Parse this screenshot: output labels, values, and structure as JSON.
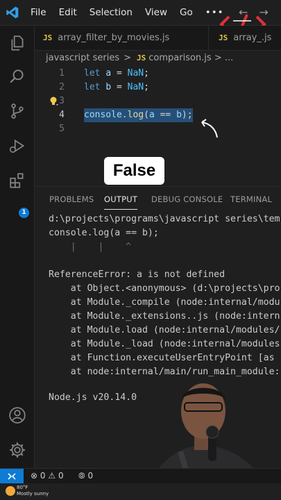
{
  "menu": {
    "file": "File",
    "edit": "Edit",
    "selection": "Selection",
    "view": "View",
    "go": "Go",
    "more": "•••"
  },
  "nav": {
    "back": "←",
    "forward": "→"
  },
  "tabs": [
    {
      "icon": "JS",
      "label": "array_filter_by_movies.js"
    },
    {
      "icon": "JS",
      "label": "array_.js"
    }
  ],
  "breadcrumb": {
    "folder": "javascript series",
    "chevron": ">",
    "icon": "JS",
    "file": "comparison.js",
    "more": "> ..."
  },
  "editor": {
    "lines": [
      {
        "num": "1",
        "kw": "let",
        "var": "a",
        "op": " = ",
        "val": "NaN",
        "end": ";"
      },
      {
        "num": "2",
        "kw": "let",
        "var": "b",
        "op": " = ",
        "val": "NaN",
        "end": ";"
      },
      {
        "num": "3"
      },
      {
        "num": "4",
        "obj": "console",
        "dot": ".",
        "fn": "log",
        "args_open": "(",
        "a": "a",
        "cmp": " == ",
        "b": "b",
        "args_close": ");"
      },
      {
        "num": "5"
      }
    ]
  },
  "caption": "False",
  "panel": {
    "tabs": {
      "problems": "PROBLEMS",
      "output": "OUTPUT",
      "debug": "DEBUG CONSOLE",
      "terminal": "TERMINAL"
    },
    "output_lines": [
      "d:\\projects\\programs\\javascript series\\tem",
      "console.log(a == b);",
      "    |    |    ^",
      "",
      "ReferenceError: a is not defined",
      "    at Object.<anonymous> (d:\\projects\\pro",
      "    at Module._compile (node:internal/modu",
      "    at Module._extensions..js (node:intern",
      "    at Module.load (node:internal/modules/",
      "    at Module._load (node:internal/modules",
      "    at Function.executeUserEntryPoint [as",
      "    at node:internal/main/run_main_module:",
      "",
      "Node.js v20.14.0"
    ]
  },
  "activity_badge": "1",
  "status": {
    "errors": "0",
    "warnings": "0",
    "ports": "0"
  },
  "taskbar": {
    "temp": "80°F",
    "weather": "Mostly sunny"
  },
  "colors": {
    "accent": "#0e7cd4",
    "selection": "#264f78",
    "keyword": "#569cd6",
    "variable": "#9cdcfe",
    "function": "#dcdcaa",
    "js_icon": "#e2c14b"
  }
}
